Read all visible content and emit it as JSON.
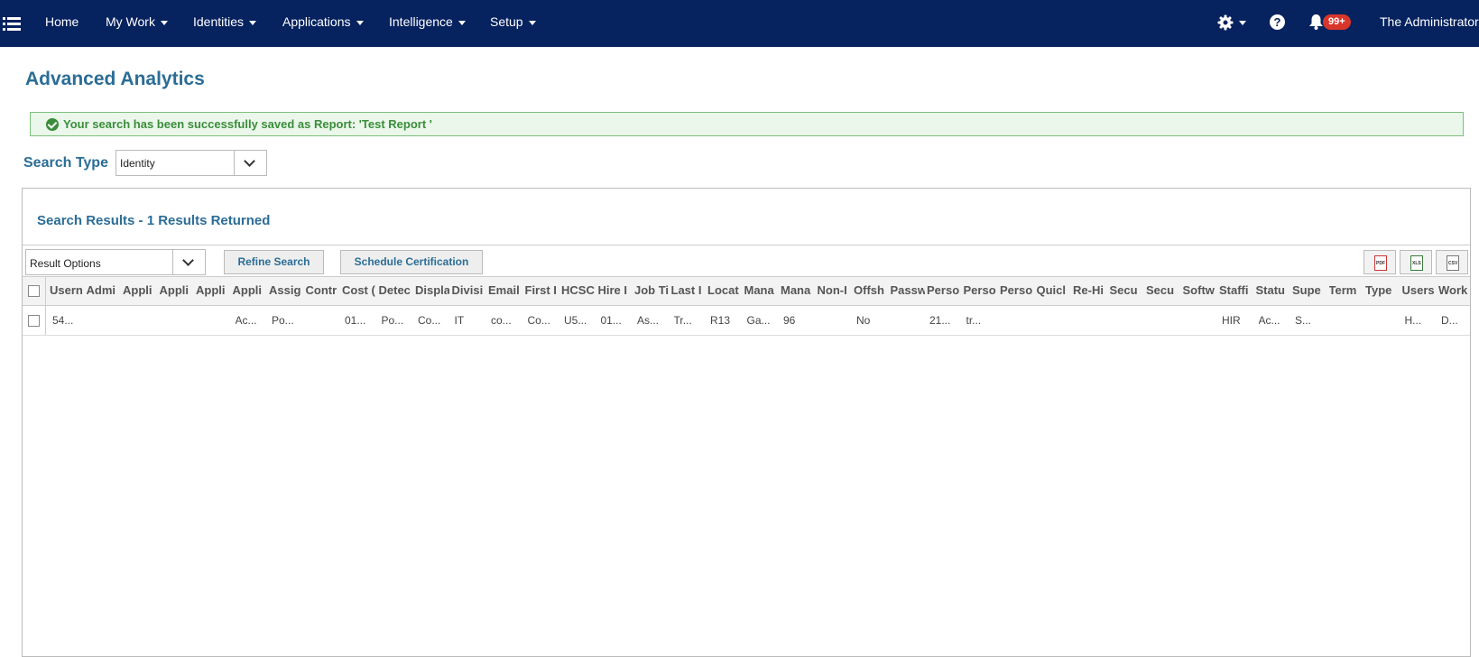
{
  "nav": {
    "items": [
      "Home",
      "My Work",
      "Identities",
      "Applications",
      "Intelligence",
      "Setup"
    ],
    "notification_count": "99+",
    "user_name": "The Administrator"
  },
  "page": {
    "title": "Advanced Analytics",
    "alert": "Your search has been successfully saved as Report: 'Test Report '",
    "search_type_label": "Search Type",
    "search_type_value": "Identity"
  },
  "results": {
    "title": "Search Results - 1 Results Returned",
    "options_value": "Result Options",
    "refine_label": "Refine Search",
    "schedule_label": "Schedule Certification",
    "exports": [
      "PDF",
      "XLS",
      "CSV"
    ],
    "columns": [
      "Usern",
      "Admi",
      "Appli",
      "Appli",
      "Appli",
      "Appli",
      "Assig",
      "Contr",
      "Cost (",
      "Detec",
      "Displa",
      "Divisi",
      "Email",
      "First I",
      "HCSC",
      "Hire I",
      "Job Ti",
      "Last I",
      "Locat",
      "Mana",
      "Mana",
      "Non-I",
      "Offsh",
      "Passw",
      "Perso",
      "Perso",
      "Perso",
      "Quicl",
      "Re-Hi",
      "Secu",
      "Secu",
      "Softw",
      "Staffi",
      "Statu",
      "Supe",
      "Term",
      "Type",
      "Users",
      "Work"
    ],
    "rows": [
      [
        "54...",
        "",
        "",
        "",
        "",
        "Ac...",
        "Po...",
        "",
        "01...",
        "Po...",
        "Co...",
        "IT",
        "co...",
        "Co...",
        "U5...",
        "01...",
        "As...",
        "Tr...",
        "R13",
        "Ga...",
        "96",
        "",
        "No",
        "",
        "21...",
        "tr...",
        "",
        "",
        "",
        "",
        "",
        "",
        "HIR",
        "Ac...",
        "S...",
        "",
        "",
        "H...",
        "D..."
      ]
    ]
  }
}
